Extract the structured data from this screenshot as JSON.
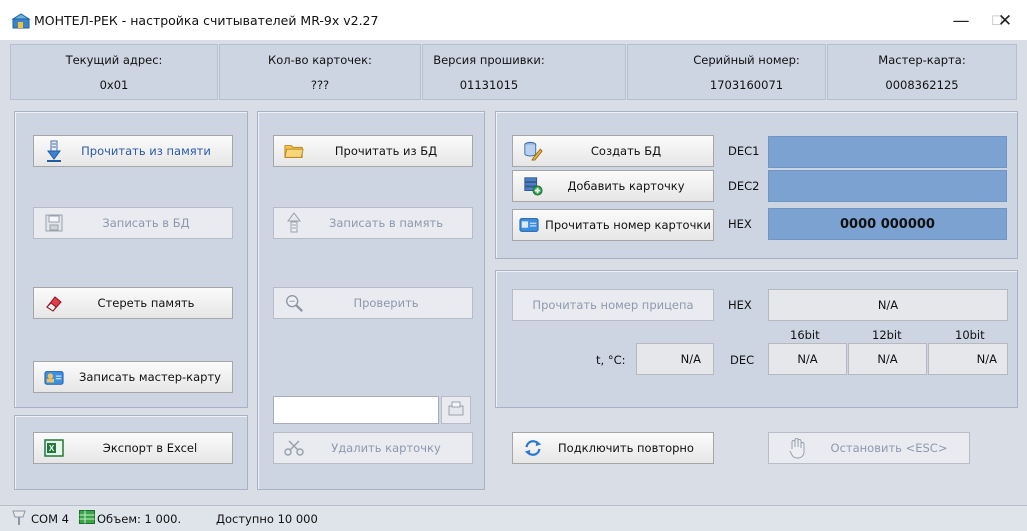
{
  "title": "МОНТЕЛ-РЕК - настройка считывателей MR-9x v2.27",
  "window_controls": {
    "minimize": "—",
    "maximize": "☐",
    "close": "✕"
  },
  "info": [
    {
      "label": "Текущий адрес:",
      "value": "0x01"
    },
    {
      "label": "Кол-во карточек:",
      "value": "???"
    },
    {
      "label": "Версия прошивки:",
      "value": "01131015"
    },
    {
      "label": "Серийный номер:",
      "value": "1703160071"
    },
    {
      "label": "Мастер-карта:",
      "value": "0008362125"
    }
  ],
  "left_panel": {
    "read_memory": "Прочитать из памяти",
    "write_db": "Записать в БД",
    "erase_memory": "Стереть память",
    "write_master": "Записать мастер-карту",
    "export_excel": "Экспорт в Excel"
  },
  "middle_panel": {
    "read_db": "Прочитать из БД",
    "write_memory": "Записать в память",
    "check": "Проверить",
    "card_input_value": "",
    "delete_card": "Удалить карточку"
  },
  "right_top": {
    "create_db": "Создать БД",
    "add_card": "Добавить карточку",
    "read_card_number": "Прочитать номер карточки",
    "dec1_label": "DEC1",
    "dec2_label": "DEC2",
    "hex_label": "HEX",
    "dec1_value": "",
    "dec2_value": "",
    "hex_value": "0000 000000"
  },
  "right_bottom": {
    "read_trailer": "Прочитать номер прицепа",
    "hex_label": "HEX",
    "hex_value": "N/A",
    "col16": "16bit",
    "col12": "12bit",
    "col10": "10bit",
    "temp_label": "t, °C:",
    "temp_value": "N/A",
    "dec_label": "DEC",
    "dec16": "N/A",
    "dec12": "N/A",
    "dec10": "N/A"
  },
  "bottom_buttons": {
    "reconnect": "Подключить повторно",
    "stop": "Остановить <ESC>"
  },
  "status": {
    "port": "COM 4",
    "volume": "Объем: 1 000.",
    "available": "Доступно 10 000"
  },
  "colors": {
    "accent_blue": "#7ba2d1",
    "panel": "#cdd5e3",
    "background": "#d9dde6"
  }
}
